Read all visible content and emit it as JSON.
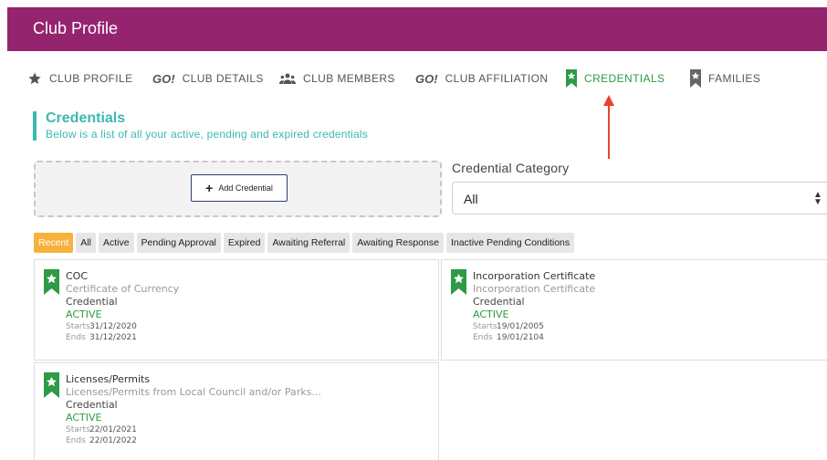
{
  "header": {
    "title": "Club Profile"
  },
  "tabs": [
    {
      "label": "CLUB PROFILE",
      "icon": "star-icon"
    },
    {
      "label": "CLUB DETAILS",
      "icon": "go-logo-icon",
      "icon_text": "GO!"
    },
    {
      "label": "CLUB MEMBERS",
      "icon": "people-icon"
    },
    {
      "label": "CLUB AFFILIATION",
      "icon": "go-logo-icon",
      "icon_text": "GO!"
    },
    {
      "label": "CREDENTIALS",
      "icon": "credential-ribbon-icon",
      "active": true
    },
    {
      "label": "FAMILIES",
      "icon": "ribbon-icon"
    }
  ],
  "section": {
    "title": "Credentials",
    "subtitle": "Below is a list of all your active, pending and expired credentials"
  },
  "add_button": {
    "label": "Add Credential",
    "icon": "plus-icon"
  },
  "category": {
    "label": "Credential Category",
    "value": "All"
  },
  "filters": [
    "Recent",
    "All",
    "Active",
    "Pending Approval",
    "Expired",
    "Awaiting Referral",
    "Awaiting Response",
    "Inactive Pending Conditions"
  ],
  "cards": [
    {
      "title": "COC",
      "subtitle": "Certificate of Currency",
      "type": "Credential",
      "status": "ACTIVE",
      "starts_label": "Starts",
      "starts": "31/12/2020",
      "ends_label": "Ends",
      "ends": "31/12/2021"
    },
    {
      "title": "Incorporation Certificate",
      "subtitle": "Incorporation Certificate",
      "type": "Credential",
      "status": "ACTIVE",
      "starts_label": "Starts",
      "starts": "19/01/2005",
      "ends_label": "Ends",
      "ends": "19/01/2104"
    },
    {
      "title": "Licenses/Permits",
      "subtitle": "Licenses/Permits from Local Council and/or Parks...",
      "type": "Credential",
      "status": "ACTIVE",
      "starts_label": "Starts",
      "starts": "22/01/2021",
      "ends_label": "Ends",
      "ends": "22/01/2022"
    }
  ],
  "colors": {
    "header_bg": "#95246f",
    "accent_teal": "#3bb8b0",
    "active_green": "#2e9a45",
    "filter_active": "#f6b23c",
    "annotation_arrow": "#e8432b"
  }
}
